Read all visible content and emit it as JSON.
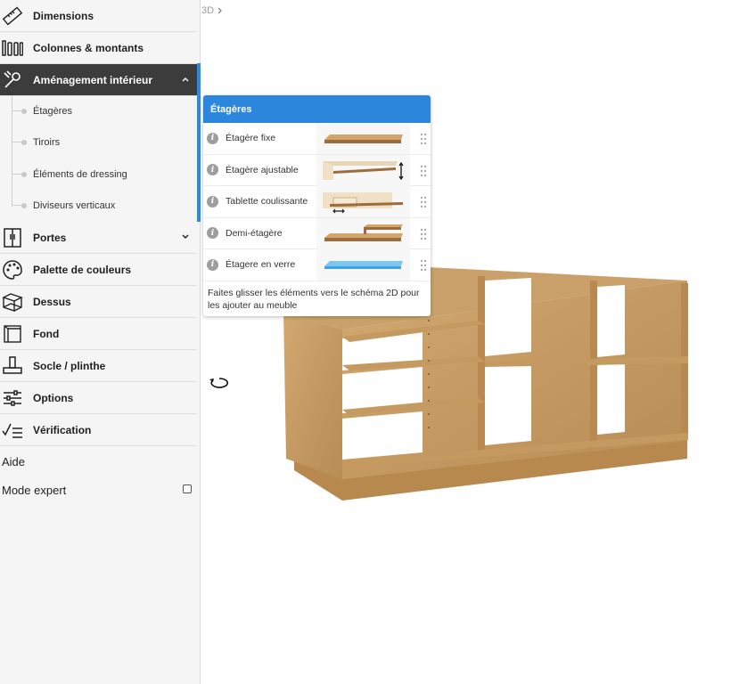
{
  "breadcrumb": {
    "label": "3D"
  },
  "sidebar": {
    "items": [
      {
        "label": "Dimensions",
        "icon": "ruler-icon"
      },
      {
        "label": "Colonnes & montants",
        "icon": "columns-icon"
      },
      {
        "label": "Aménagement intérieur",
        "icon": "wrench-icon"
      },
      {
        "label": "Portes",
        "icon": "door-icon"
      },
      {
        "label": "Palette de couleurs",
        "icon": "palette-icon"
      },
      {
        "label": "Dessus",
        "icon": "top-box-icon"
      },
      {
        "label": "Fond",
        "icon": "back-panel-icon"
      },
      {
        "label": "Socle / plinthe",
        "icon": "plinth-icon"
      },
      {
        "label": "Options",
        "icon": "sliders-icon"
      },
      {
        "label": "Vérification",
        "icon": "checklist-icon"
      }
    ],
    "subitems": [
      {
        "label": "Étagères"
      },
      {
        "label": "Tiroirs"
      },
      {
        "label": "Éléments de dressing"
      },
      {
        "label": "Diviseurs verticaux"
      }
    ],
    "help_label": "Aide",
    "expert_mode": {
      "label": "Mode expert",
      "checked": false
    }
  },
  "popup": {
    "title": "Étagères",
    "items": [
      {
        "label": "Étagère fixe",
        "thumb": "fixed-shelf"
      },
      {
        "label": "Étagère ajustable",
        "thumb": "adjustable-shelf"
      },
      {
        "label": "Tablette coulissante",
        "thumb": "sliding-shelf"
      },
      {
        "label": "Demi-étagère",
        "thumb": "half-shelf"
      },
      {
        "label": "Étagere en verre",
        "thumb": "glass-shelf"
      }
    ],
    "footer": "Faites glisser les éléments vers le schéma 2D pour les ajouter au meuble"
  },
  "colors": {
    "accent": "#2b86dc",
    "active_item": "#3c3c3c",
    "wood": "#c9a06a"
  }
}
